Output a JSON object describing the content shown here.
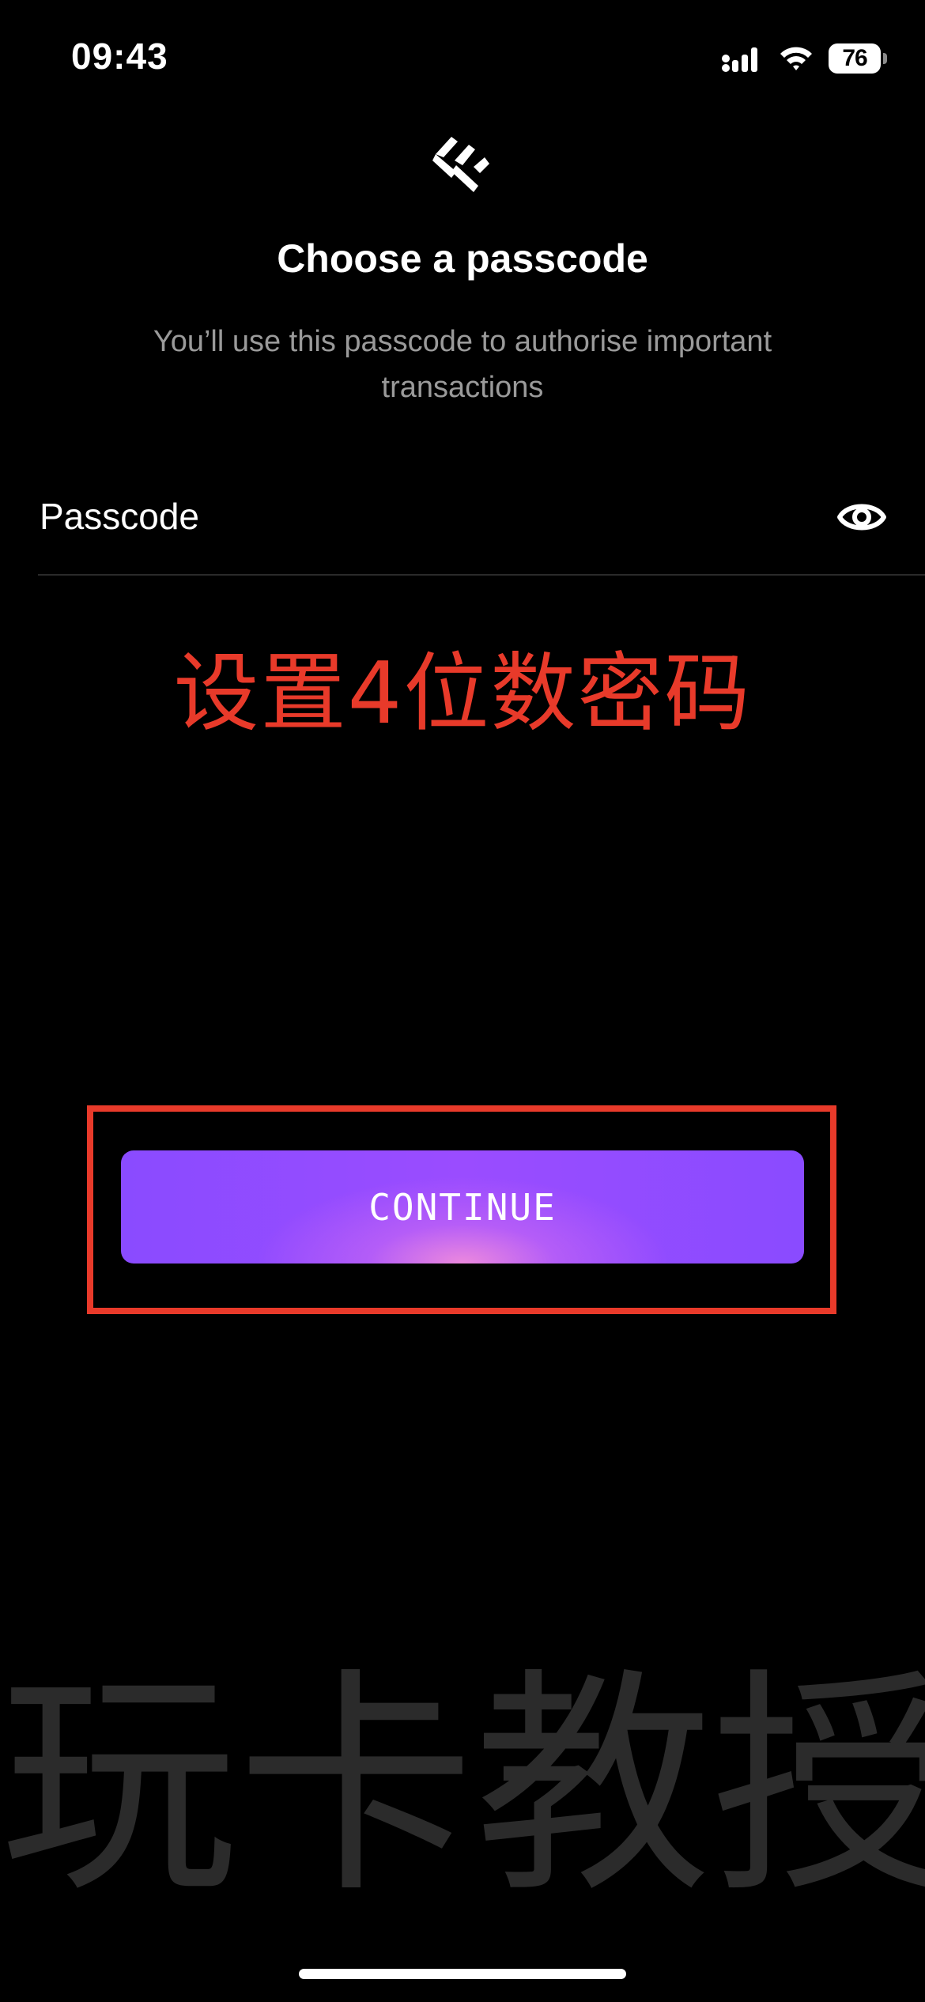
{
  "status_bar": {
    "time": "09:43",
    "battery": "76"
  },
  "header": {
    "title": "Choose a passcode",
    "subtitle": "You’ll use this passcode to authorise important transactions"
  },
  "passcode_field": {
    "label": "Passcode",
    "toggle_icon": "eye-icon"
  },
  "annotation": {
    "text": "设置4位数密码",
    "color": "#e83a2a"
  },
  "actions": {
    "continue_label": "CONTINUE",
    "accent_color": "#8a4bff"
  },
  "watermark": {
    "text": "玩卡教授"
  }
}
